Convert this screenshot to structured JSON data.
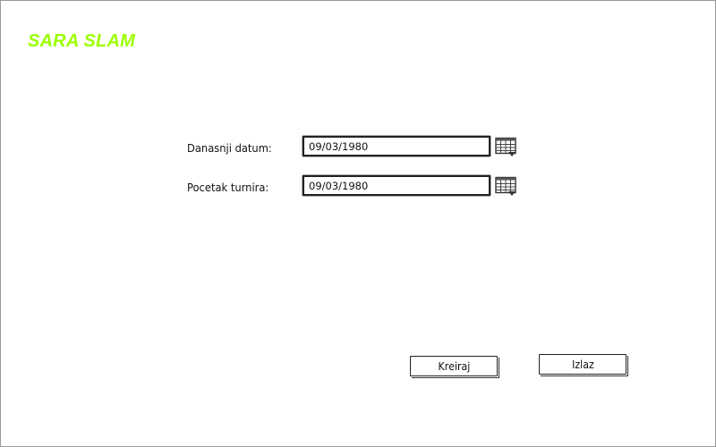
{
  "app": {
    "title": "SARA SLAM",
    "title_color": "#9cff00"
  },
  "form": {
    "today": {
      "label": "Danasnji datum:",
      "value": "09/03/1980",
      "calendar_icon": "calendar-icon"
    },
    "tournament_start": {
      "label": "Pocetak turnira:",
      "value": "09/03/1980",
      "calendar_icon": "calendar-icon"
    }
  },
  "actions": {
    "create_label": "Kreiraj",
    "exit_label": "Izlaz"
  }
}
